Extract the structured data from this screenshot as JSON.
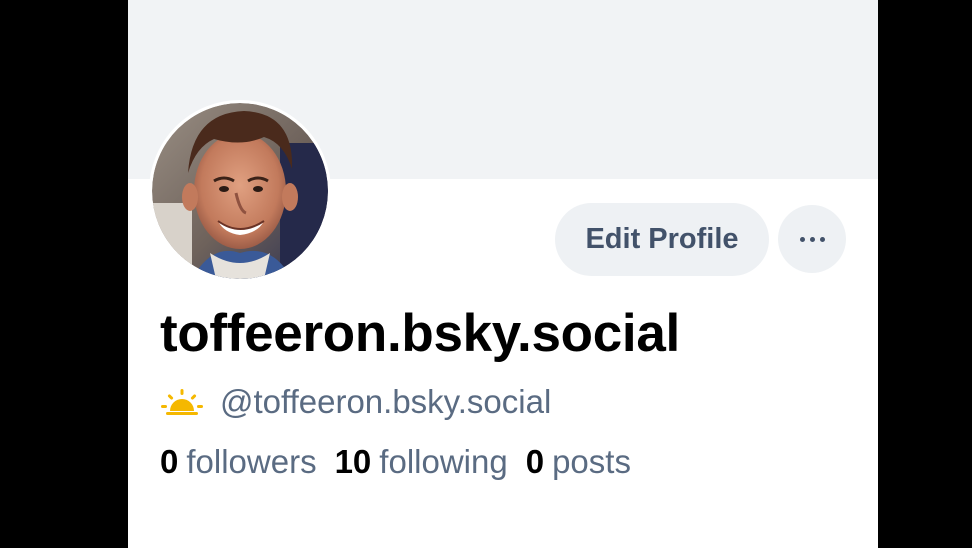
{
  "profile": {
    "display_name": "toffeeron.bsky.social",
    "handle": "@toffeeron.bsky.social",
    "edit_button_label": "Edit Profile",
    "more_button_icon": "more-horizontal-icon",
    "badge_icon": "sunrise-icon",
    "stats": {
      "followers_count": "0",
      "followers_label": "followers",
      "following_count": "10",
      "following_label": "following",
      "posts_count": "0",
      "posts_label": "posts"
    }
  },
  "colors": {
    "banner": "#f1f3f5",
    "button_bg": "#eef1f4",
    "secondary_text": "#5a6b82",
    "badge_yellow": "#f5b800"
  }
}
